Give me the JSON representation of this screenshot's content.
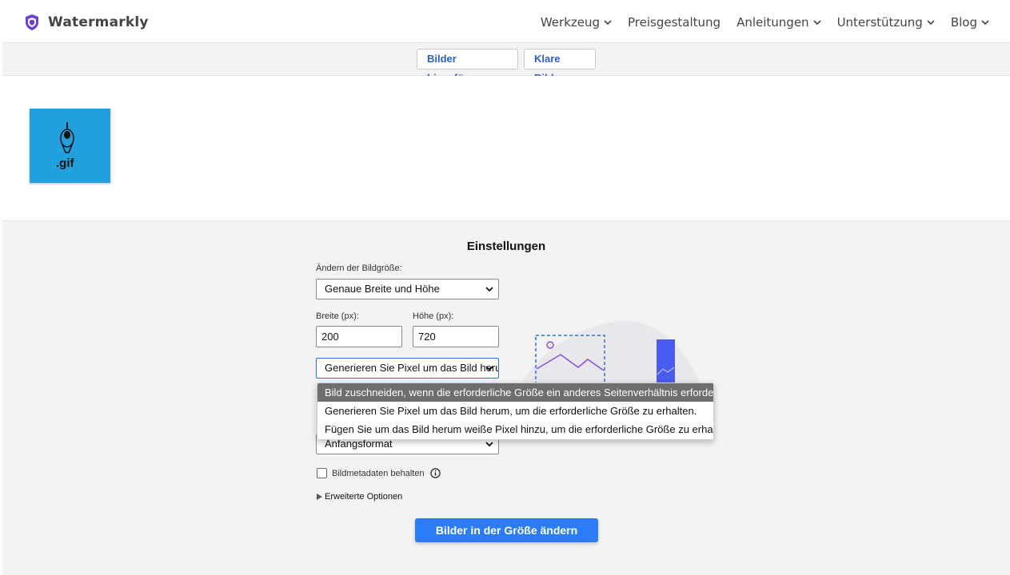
{
  "brand": {
    "name": "Watermarkly",
    "color": "#6a3fd8"
  },
  "nav": [
    {
      "label": "Werkzeug",
      "has_menu": true
    },
    {
      "label": "Preisgestaltung",
      "has_menu": false
    },
    {
      "label": "Anleitungen",
      "has_menu": true
    },
    {
      "label": "Unterstützung",
      "has_menu": true
    },
    {
      "label": "Blog",
      "has_menu": true
    }
  ],
  "toolbar": {
    "add_label": "Bilder hinzufügen",
    "clear_label": "Klare Bilder"
  },
  "image": {
    "thumb_label": ".gif",
    "thumb_color": "#21a0dd"
  },
  "settings": {
    "title": "Einstellungen",
    "resize_label": "Ändern der Bildgröße:",
    "resize_value": "Genaue Breite und Höhe",
    "width_label": "Breite (px):",
    "width_value": "200",
    "height_label": "Höhe (px):",
    "height_value": "720",
    "fit_value": "Generieren Sie Pixel um das Bild herum, um die erforderliche Größe zu erhalten.",
    "fit_options": [
      "Bild zuschneiden, wenn die erforderliche Größe ein anderes Seitenverhältnis erfordert.",
      "Generieren Sie Pixel um das Bild herum, um die erforderliche Größe zu erhalten.",
      "Fügen Sie um das Bild herum weiße Pixel hinzu, um die erforderliche Größe zu erhalten."
    ],
    "format_value": "Anfangsformat",
    "metadata_label": "Bildmetadaten behalten",
    "metadata_checked": false,
    "advanced_label": "Erweiterte Optionen",
    "submit_label": "Bilder in der Größe ändern"
  },
  "colors": {
    "accent": "#2d7cf7",
    "link": "#2a5fc9",
    "illustration": "#7b4ff0"
  }
}
